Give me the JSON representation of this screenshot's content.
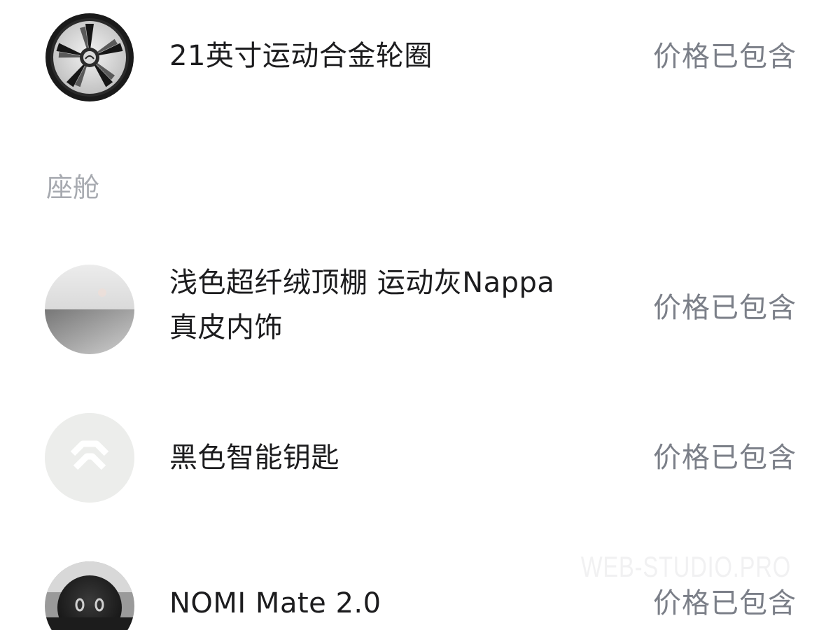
{
  "items": [
    {
      "label": "21英寸运动合金轮圈",
      "price": "价格已包含",
      "icon": "wheel-icon"
    },
    {
      "label": "浅色超纤绒顶棚 运动灰Nappa\n真皮内饰",
      "price": "价格已包含",
      "icon": "interior-swatch-icon"
    },
    {
      "label": "黑色智能钥匙",
      "price": "价格已包含",
      "icon": "nio-key-icon"
    },
    {
      "label": "NOMI Mate 2.0",
      "price": "价格已包含",
      "icon": "nomi-icon"
    }
  ],
  "section": {
    "title": "座舱"
  },
  "watermark": {
    "text": "WEB-STUDIO.PRO"
  },
  "colors": {
    "label": "#1c1c1e",
    "price": "#7b7f88",
    "section": "#a7aab0"
  }
}
